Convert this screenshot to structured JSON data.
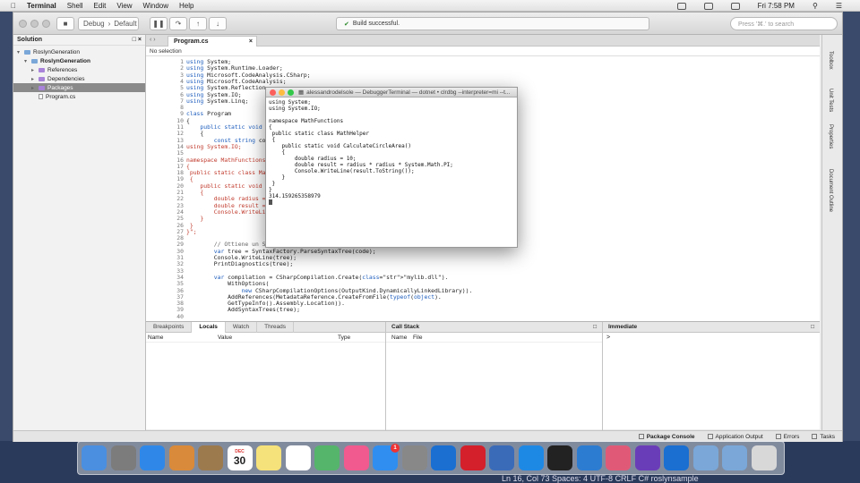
{
  "menubar": {
    "app": "Terminal",
    "items": [
      "Shell",
      "Edit",
      "View",
      "Window",
      "Help"
    ],
    "clock": "Fri 7:58 PM"
  },
  "toolbar": {
    "config": "Debug",
    "target": "Default",
    "status": "Build successful.",
    "search_placeholder": "Press '⌘.' to search"
  },
  "solution": {
    "title": "Solution",
    "items": [
      {
        "label": "RoslynGeneration",
        "level": 0,
        "icon": "solution"
      },
      {
        "label": "RoslynGeneration",
        "level": 1,
        "icon": "project",
        "bold": true
      },
      {
        "label": "References",
        "level": 2,
        "icon": "folder"
      },
      {
        "label": "Dependencies",
        "level": 2,
        "icon": "folder"
      },
      {
        "label": "Packages",
        "level": 2,
        "icon": "folder",
        "selected": true
      },
      {
        "label": "Program.cs",
        "level": 2,
        "icon": "file"
      }
    ]
  },
  "editor": {
    "tab": "Program.cs",
    "nav": "No selection",
    "lines": [
      {
        "n": "1",
        "t": "using System;"
      },
      {
        "n": "2",
        "t": "using System.Runtime.Loader;"
      },
      {
        "n": "3",
        "t": "using Microsoft.CodeAnalysis.CSharp;"
      },
      {
        "n": "4",
        "t": "using Microsoft.CodeAnalysis;"
      },
      {
        "n": "5",
        "t": "using System.Reflection;"
      },
      {
        "n": "6",
        "t": "using System.IO;"
      },
      {
        "n": "7",
        "t": "using System.Linq;"
      },
      {
        "n": "8",
        "t": ""
      },
      {
        "n": "9",
        "t": "class Program"
      },
      {
        "n": "10",
        "t": "{"
      },
      {
        "n": "11",
        "t": "    public static void Main(string[] args)"
      },
      {
        "n": "12",
        "t": "    {"
      },
      {
        "n": "13",
        "t": "        const string code = @\""
      },
      {
        "n": "14",
        "t": "using System.IO;"
      },
      {
        "n": "15",
        "t": ""
      },
      {
        "n": "16",
        "t": "namespace MathFunctions"
      },
      {
        "n": "17",
        "t": "{"
      },
      {
        "n": "18",
        "t": " public static class MathHelper"
      },
      {
        "n": "19",
        "t": " {"
      },
      {
        "n": "20",
        "t": "    public static void CalculateCircleArea()"
      },
      {
        "n": "21",
        "t": "    {"
      },
      {
        "n": "22",
        "t": "        double radius = 10;"
      },
      {
        "n": "23",
        "t": "        double result = radius * radius * System.Math.PI;"
      },
      {
        "n": "24",
        "t": "        Console.WriteLine(result.ToString());"
      },
      {
        "n": "25",
        "t": "    }"
      },
      {
        "n": "26",
        "t": " }"
      },
      {
        "n": "27",
        "t": "}\";"
      },
      {
        "n": "28",
        "t": ""
      },
      {
        "n": "29",
        "t": "        // Ottiene un SyntaxTree"
      },
      {
        "n": "30",
        "t": "        var tree = SyntaxFactory.ParseSyntaxTree(code);"
      },
      {
        "n": "31",
        "t": "        Console.WriteLine(tree);"
      },
      {
        "n": "32",
        "t": "        PrintDiagnostics(tree);"
      },
      {
        "n": "33",
        "t": ""
      },
      {
        "n": "34",
        "t": "        var compilation = CSharpCompilation.Create(\"mylib.dll\")."
      },
      {
        "n": "35",
        "t": "            WithOptions("
      },
      {
        "n": "36",
        "t": "                new CSharpCompilationOptions(OutputKind.DynamicallyLinkedLibrary))."
      },
      {
        "n": "37",
        "t": "            AddReferences(MetadataReference.CreateFromFile(typeof(object)."
      },
      {
        "n": "38",
        "t": "            GetTypeInfo().Assembly.Location))."
      },
      {
        "n": "39",
        "t": "            AddSyntaxTrees(tree);"
      },
      {
        "n": "40",
        "t": ""
      }
    ]
  },
  "terminal": {
    "title": "alessandrodelsole — DebuggerTerminal — dotnet • clrdbg --interpreter=mi --t...",
    "lines": [
      "using System;",
      "using System.IO;",
      "",
      "namespace MathFunctions",
      "{",
      " public static class MathHelper",
      " {",
      "    public static void CalculateCircleArea()",
      "    {",
      "        double radius = 10;",
      "        double result = radius * radius * System.Math.PI;",
      "        Console.WriteLine(result.ToString());",
      "    }",
      " }",
      "}",
      "314.159265358979"
    ]
  },
  "bottom": {
    "tabs": [
      "Breakpoints",
      "Locals",
      "Watch",
      "Threads"
    ],
    "active_tab": "Locals",
    "locals_cols": [
      "Name",
      "Value",
      "Type"
    ],
    "callstack_title": "Call Stack",
    "callstack_cols": [
      "Name",
      "File"
    ],
    "immediate_title": "Immediate"
  },
  "right_strip": [
    "Toolbox",
    "Unit Tests",
    "Properties",
    "Document Outline"
  ],
  "statusbar": {
    "items": [
      "Package Console",
      "Application Output",
      "Errors",
      "Tasks"
    ]
  },
  "under_dock": "Ln 16, Col 73    Spaces: 4    UTF-8    CRLF    C#    roslynsample",
  "dock": {
    "icons": [
      "finder-icon",
      "launchpad-icon",
      "safari-icon",
      "preview-icon",
      "contacts-icon",
      "calendar-icon",
      "notes-icon",
      "reminders-icon",
      "maps-icon",
      "itunes-icon",
      "appstore-icon",
      "system-preferences-icon",
      "teamviewer-icon",
      "parallels-icon",
      "remote-desktop-icon",
      "xcode-icon",
      "terminal-icon",
      "vscode-icon",
      "xamarin-icon",
      "visual-studio-icon",
      "teamviewer2-icon",
      "folder-icon",
      "folder2-icon",
      "trash-icon"
    ],
    "calendar_day": "30",
    "calendar_month": "DEC",
    "appstore_badge": "1"
  }
}
